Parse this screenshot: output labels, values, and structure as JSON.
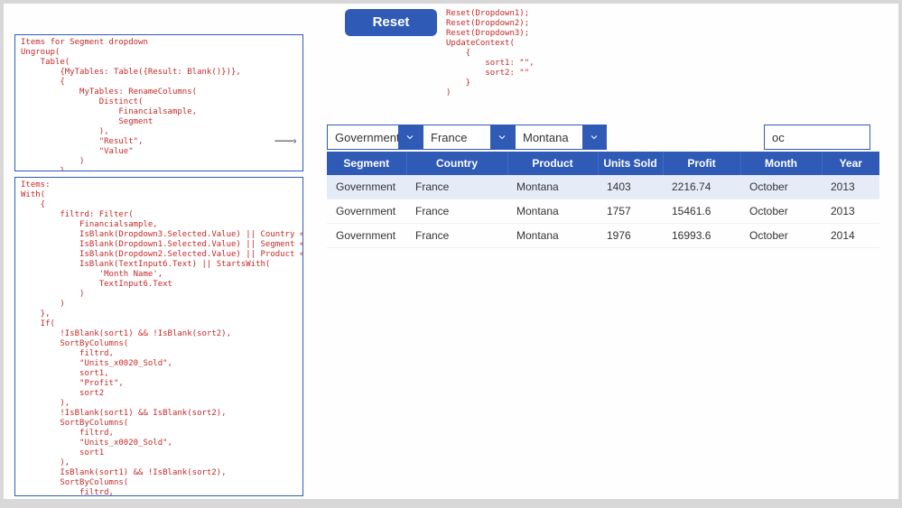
{
  "reset_btn": "Reset",
  "reset_code": "Reset(Dropdown1);\nReset(Dropdown2);\nReset(Dropdown3);\nUpdateContext(\n    {\n        sort1: \"\",\n        sort2: \"\"\n    }\n)",
  "code_box_1": "Items for Segment dropdown\nUngroup(\n    Table(\n        {MyTables: Table({Result: Blank()})},\n        {\n            MyTables: RenameColumns(\n                Distinct(\n                    Financialsample,\n                    Segment\n                ),\n                \"Result\",\n                \"Value\"\n            )\n        }\n    ),\n    \"MyTables\"\n)",
  "code_box_2": "Items:\nWith(\n    {\n        filtrd: Filter(\n            Financialsample,\n            IsBlank(Dropdown3.Selected.Value) || Country = Dropdown3.Selected.Value,\n            IsBlank(Dropdown1.Selected.Value) || Segment = Dropdown1.Selected.Value,\n            IsBlank(Dropdown2.Selected.Value) || Product = Dropdown2.Selected.Value,\n            IsBlank(TextInput6.Text) || StartsWith(\n                'Month Name',\n                TextInput6.Text\n            )\n        )\n    },\n    If(\n        !IsBlank(sort1) && !IsBlank(sort2),\n        SortByColumns(\n            filtrd,\n            \"Units_x0020_Sold\",\n            sort1,\n            \"Profit\",\n            sort2\n        ),\n        !IsBlank(sort1) && IsBlank(sort2),\n        SortByColumns(\n            filtrd,\n            \"Units_x0020_Sold\",\n            sort1\n        ),\n        IsBlank(sort1) && !IsBlank(sort2),\n        SortByColumns(\n            filtrd,\n            \"Profit\",\n            sort2\n        ),\n        SortByColumns(\n            filtrd,\n            \"Date\",\n            Ascending\n        )\n    )\n)",
  "dropdowns": {
    "segment": "Government",
    "country": "France",
    "product": "Montana"
  },
  "search_value": "oc",
  "table": {
    "headers": [
      "Segment",
      "Country",
      "Product",
      "Units Sold",
      "Profit",
      "Month",
      "Year"
    ],
    "rows": [
      {
        "segment": "Government",
        "country": "France",
        "product": "Montana",
        "units": "1403",
        "profit": "2216.74",
        "month": "October",
        "year": "2013"
      },
      {
        "segment": "Government",
        "country": "France",
        "product": "Montana",
        "units": "1757",
        "profit": "15461.6",
        "month": "October",
        "year": "2013"
      },
      {
        "segment": "Government",
        "country": "France",
        "product": "Montana",
        "units": "1976",
        "profit": "16993.6",
        "month": "October",
        "year": "2014"
      }
    ]
  },
  "arrow": "---------›"
}
